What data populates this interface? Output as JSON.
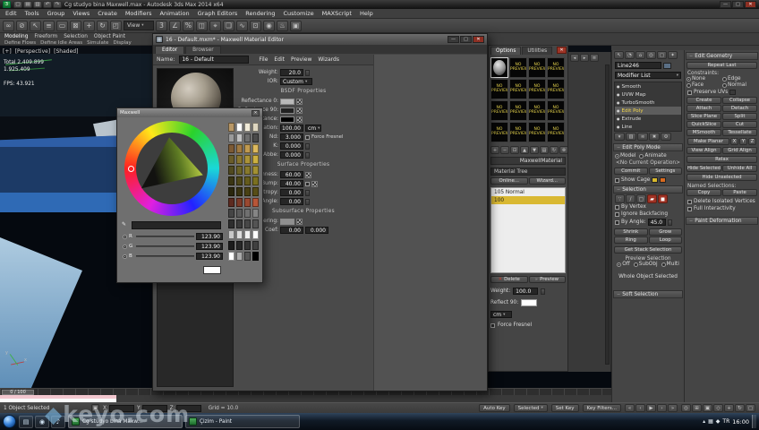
{
  "titlebar": {
    "title": "Cg studyo bina Maxwell.max - Autodesk 3ds Max 2014 x64",
    "qat_icons": [
      {
        "name": "new-file-icon",
        "glyph": "▢"
      },
      {
        "name": "open-file-icon",
        "glyph": "▤"
      },
      {
        "name": "save-file-icon",
        "glyph": "▥"
      },
      {
        "name": "undo-icon",
        "glyph": "↶"
      },
      {
        "name": "redo-icon",
        "glyph": "↷"
      }
    ]
  },
  "menu_bar": {
    "items": [
      "Edit",
      "Tools",
      "Group",
      "Views",
      "Create",
      "Modifiers",
      "Animation",
      "Graph Editors",
      "Rendering",
      "Customize",
      "MAXScript",
      "Help"
    ]
  },
  "toolbar": {
    "ref_coord": "View",
    "icons": [
      {
        "name": "select-link-icon",
        "glyph": "∞"
      },
      {
        "name": "unlink-selection-icon",
        "glyph": "⊘"
      },
      {
        "name": "select-object-icon",
        "glyph": "↖"
      },
      {
        "name": "select-by-name-icon",
        "glyph": "≡"
      },
      {
        "name": "rectangular-selection-icon",
        "glyph": "▭"
      },
      {
        "name": "crossing-selection-icon",
        "glyph": "⊠"
      },
      {
        "name": "select-move-icon",
        "glyph": "+"
      },
      {
        "name": "select-rotate-icon",
        "glyph": "↻"
      },
      {
        "name": "select-scale-icon",
        "glyph": "◰"
      },
      {
        "name": "reference-coordinate-dropdown",
        "glyph": ""
      },
      {
        "name": "snap-toggle-icon",
        "glyph": "3"
      },
      {
        "name": "angle-snap-icon",
        "glyph": "∠"
      },
      {
        "name": "percent-snap-icon",
        "glyph": "%"
      },
      {
        "name": "mirror-icon",
        "glyph": "◫"
      },
      {
        "name": "align-icon",
        "glyph": "⌖"
      },
      {
        "name": "layer-manager-icon",
        "glyph": "❏"
      },
      {
        "name": "curve-editor-icon",
        "glyph": "∿"
      },
      {
        "name": "schematic-view-icon",
        "glyph": "⊡"
      },
      {
        "name": "material-editor-icon",
        "glyph": "◉"
      },
      {
        "name": "render-setup-icon",
        "glyph": "♨"
      },
      {
        "name": "render-production-icon",
        "glyph": "▣"
      }
    ]
  },
  "ribbon": {
    "tabs": [
      "Modeling",
      "Freeform",
      "Selection",
      "Object Paint"
    ],
    "tools": [
      "Define Flows",
      "Define Idle Areas",
      "Simulate",
      "Display"
    ]
  },
  "viewport": {
    "label_plus": "[+]",
    "label_view": "[Perspective]",
    "label_shading": "[Shaded]",
    "stats_lines": [
      "Total  2.409.899",
      "1.925.409"
    ],
    "fps": "FPS: 43.921",
    "axis_x": "x",
    "axis_y": "y"
  },
  "maxwell": {
    "title": "16 - Default.mxm* - Maxwell Material Editor",
    "tabs": [
      "Editor",
      "Browser"
    ],
    "name_label": "Name:",
    "name_value": "16 - Default",
    "menus": [
      "File",
      "Edit",
      "Preview",
      "Wizards"
    ],
    "weight_label": "Weight:",
    "weight_value": "20.0",
    "ior_label": "IOR:",
    "ior_value": "Custom",
    "bsdf_header": "BSDF Properties",
    "reflectance0_label": "Reflectance 0:",
    "reflectance0_color": "#b9b9b9",
    "reflectance90_label": "Reflectance 90:",
    "reflectance90_color": "#222222",
    "transmittance_label": "Transmittance:",
    "transmittance_color": "#000000",
    "attenuation_label": "Attenuation:",
    "attenuation_value": "100.00",
    "attenuation_unit": "cm",
    "nd_label": "Nd:",
    "nd_value": "3.000",
    "force_fresnel": "Force Fresnel",
    "k_label": "K:",
    "k_value": "0.000",
    "abbe_label": "Abbe:",
    "abbe_value": "0.000",
    "surface_header": "Surface Properties",
    "roughness_label": "Roughness:",
    "roughness_value": "60.00",
    "bump_label": "Bump:",
    "bump_value": "40.00",
    "anisotropy_label": "Anisotropy:",
    "anisotropy_value": "0.00",
    "angle_label": "Angle:",
    "angle_value": "0.00",
    "subsurface_header": "Subsurface Properties",
    "scattering_label": "Scattering:",
    "scattering_color": "#8f8f8f",
    "coef_label": "Coef:",
    "coef_value": "0.00",
    "asymmetry_value": "0.000"
  },
  "color_picker": {
    "title": "Maxwell",
    "channels": [
      {
        "label": "R",
        "value": "123.90"
      },
      {
        "label": "G",
        "value": "123.90"
      },
      {
        "label": "B",
        "value": "123.90"
      }
    ],
    "palette": [
      "#b99867",
      "#ffffff",
      "#f0ead8",
      "#ddd6c0",
      "#9a9a9a",
      "#c0c0c0",
      "#6f6f6f",
      "#4a4a4a",
      "#7c5a35",
      "#a07a42",
      "#c09a50",
      "#dcb95e",
      "#6a5c2a",
      "#897630",
      "#ab9338",
      "#ccb040",
      "#514a20",
      "#6b6226",
      "#87792c",
      "#a39133",
      "#3b3614",
      "#4f4818",
      "#655c1c",
      "#7b7020",
      "#2b270e",
      "#3a3411",
      "#494114",
      "#584e17",
      "#5d2b20",
      "#7c3a28",
      "#9a4830",
      "#b85638",
      "#454545",
      "#5a5a5a",
      "#707070",
      "#858585",
      "#2e2e2e",
      "#3a3a3a",
      "#474747",
      "#545454",
      "#c8c8c8",
      "#dcdcdc",
      "#f0f0f0",
      "#ffffff",
      "#1c1c1c",
      "#282828",
      "#343434",
      "#404040",
      "#ffffff",
      "#aaaaaa",
      "#555555",
      "#000000"
    ]
  },
  "browser": {
    "tabs": [
      "Options",
      "Utilities"
    ],
    "no_preview": "NO PREVIEW",
    "type_button": "MaxwellMaterial",
    "tree_header": "Material Tree",
    "online_button": "Online...",
    "wizard_button": "Wizard...",
    "list": [
      {
        "label": "105 Normal",
        "selected": false
      },
      {
        "label": "100",
        "selected": true
      }
    ],
    "delete_button": "Delete",
    "preview_check": "Preview",
    "weight_label": "Weight:",
    "weight_value": "100.0",
    "reflect_label": "Reflect 90:",
    "reflect_color": "#ffffff",
    "unit_value": "cm",
    "force_fresnel": "Force Fresnel",
    "tool_icons": [
      {
        "name": "add-material-icon",
        "glyph": "+"
      },
      {
        "name": "remove-material-icon",
        "glyph": "−"
      },
      {
        "name": "duplicate-material-icon",
        "glyph": "⊡"
      },
      {
        "name": "move-up-icon",
        "glyph": "▲"
      },
      {
        "name": "move-down-icon",
        "glyph": "▼"
      },
      {
        "name": "browse-folder-icon",
        "glyph": "▤"
      },
      {
        "name": "refresh-preview-icon",
        "glyph": "↻"
      },
      {
        "name": "lock-preview-icon",
        "glyph": "⊗"
      }
    ]
  },
  "strip": {
    "icons": [
      {
        "name": "collapse-panel-icon",
        "glyph": "◂"
      },
      {
        "name": "expand-panel-icon",
        "glyph": "▸"
      },
      {
        "name": "panel-menu-icon",
        "glyph": "≡"
      }
    ]
  },
  "cmd": {
    "object_name": "Line246",
    "modifier_list": "Modifier List",
    "panel_tabs": [
      {
        "name": "create-tab-icon",
        "glyph": "↖"
      },
      {
        "name": "modify-tab-icon",
        "glyph": "◔"
      },
      {
        "name": "hierarchy-tab-icon",
        "glyph": "⌂"
      },
      {
        "name": "motion-tab-icon",
        "glyph": "◎"
      },
      {
        "name": "display-tab-icon",
        "glyph": "▢"
      },
      {
        "name": "utilities-tab-icon",
        "glyph": "✦"
      }
    ],
    "stack": [
      {
        "label": "Smooth"
      },
      {
        "label": "UVW Map"
      },
      {
        "label": "TurboSmooth"
      },
      {
        "label": "Edit Poly",
        "selected": true
      },
      {
        "label": "Extrude"
      },
      {
        "label": "Line"
      }
    ],
    "stack_tools": [
      {
        "name": "pin-stack-icon",
        "glyph": "▾"
      },
      {
        "name": "show-end-result-icon",
        "glyph": "▥"
      },
      {
        "name": "make-unique-icon",
        "glyph": "≋"
      },
      {
        "name": "remove-modifier-icon",
        "glyph": "✖"
      },
      {
        "name": "configure-modifier-sets-icon",
        "glyph": "⚙"
      }
    ],
    "edit_poly_mode": {
      "title": "Edit Poly Mode",
      "model": "Model",
      "animate": "Animate",
      "operation": "<No Current Operation>",
      "commit": "Commit",
      "settings": "Settings",
      "show_cage": "Show Cage"
    },
    "selection": {
      "title": "Selection",
      "icons": [
        {
          "name": "vertex-mode-icon",
          "glyph": "∵"
        },
        {
          "name": "edge-mode-icon",
          "glyph": "∕"
        },
        {
          "name": "border-mode-icon",
          "glyph": "▢"
        },
        {
          "name": "polygon-mode-icon",
          "glyph": "▰",
          "active": true
        },
        {
          "name": "element-mode-icon",
          "glyph": "◼",
          "active": true
        }
      ],
      "by_vertex": "By Vertex",
      "ignore_backfacing": "Ignore Backfacing",
      "by_angle": "By Angle:",
      "by_angle_value": "45.0",
      "shrink": "Shrink",
      "grow": "Grow",
      "ring": "Ring",
      "loop": "Loop",
      "get_stack": "Get Stack Selection",
      "preview_label": "Preview Selection",
      "preview_options": [
        "Off",
        "SubObj",
        "Multi"
      ],
      "status": "Whole Object Selected"
    },
    "soft_selection": "Soft Selection",
    "edit_geometry": {
      "title": "Edit Geometry",
      "repeat_last": "Repeat Last",
      "constraints_label": "Constraints:",
      "constraints": [
        "None",
        "Edge",
        "Face",
        "Normal"
      ],
      "preserve_uvs": "Preserve UVs",
      "pairs": [
        [
          "Create",
          "Collapse"
        ],
        [
          "Attach",
          "Detach"
        ],
        [
          "Slice Plane",
          "Split"
        ],
        [
          "QuickSlice",
          "Cut"
        ],
        [
          "MSmooth",
          "Tessellate"
        ]
      ],
      "make_planar": "Make Planar",
      "axes": [
        "X",
        "Y",
        "Z"
      ],
      "view_align": "View Align",
      "grid_align": "Grid Align",
      "relax": "Relax",
      "hide_selected": "Hide Selected",
      "unhide_all": "Unhide All",
      "hide_unselected": "Hide Unselected",
      "named_label": "Named Selections:",
      "copy": "Copy",
      "paste": "Paste",
      "delete_isolated": "Delete Isolated Vertices",
      "full_interactivity": "Full Interactivity"
    },
    "paint_deformation": "Paint Deformation"
  },
  "status": {
    "prompt": "1 Object Selected",
    "coord_labels": [
      "X:",
      "Y:",
      "Z:"
    ],
    "grid": "Grid = 10.0",
    "auto_key": "Auto Key",
    "selected": "Selected",
    "set_key": "Set Key",
    "key_filters": "Key Filters...",
    "time_label": "0 / 100",
    "time_controls": [
      {
        "name": "go-to-start-icon",
        "glyph": "«"
      },
      {
        "name": "previous-frame-icon",
        "glyph": "‹"
      },
      {
        "name": "play-icon",
        "glyph": "▶"
      },
      {
        "name": "next-frame-icon",
        "glyph": "›"
      },
      {
        "name": "go-to-end-icon",
        "glyph": "»"
      }
    ],
    "nav_icons": [
      {
        "name": "zoom-icon",
        "glyph": "◎"
      },
      {
        "name": "zoom-all-icon",
        "glyph": "⊞"
      },
      {
        "name": "zoom-extents-icon",
        "glyph": "▣"
      },
      {
        "name": "field-of-view-icon",
        "glyph": "◇"
      },
      {
        "name": "pan-icon",
        "glyph": "+"
      },
      {
        "name": "orbit-icon",
        "glyph": "↻"
      },
      {
        "name": "maximize-viewport-icon",
        "glyph": "▢"
      }
    ]
  },
  "taskbar": {
    "quick_icons": [
      {
        "name": "explorer-icon",
        "glyph": "▤"
      },
      {
        "name": "browser-icon",
        "glyph": "◉"
      },
      {
        "name": "media-icon",
        "glyph": "♪"
      }
    ],
    "buttons": [
      "Cg stüdyo bina Maxw...",
      "Çizim - Paint"
    ],
    "tray_icons": [
      {
        "name": "tray-expand-icon",
        "glyph": "▴"
      },
      {
        "name": "network-icon",
        "glyph": "▦"
      },
      {
        "name": "volume-icon",
        "glyph": "◆"
      }
    ],
    "lang": "TR",
    "time": "16:00"
  },
  "watermark": {
    "logo": "◆",
    "text": "keyo.com"
  }
}
